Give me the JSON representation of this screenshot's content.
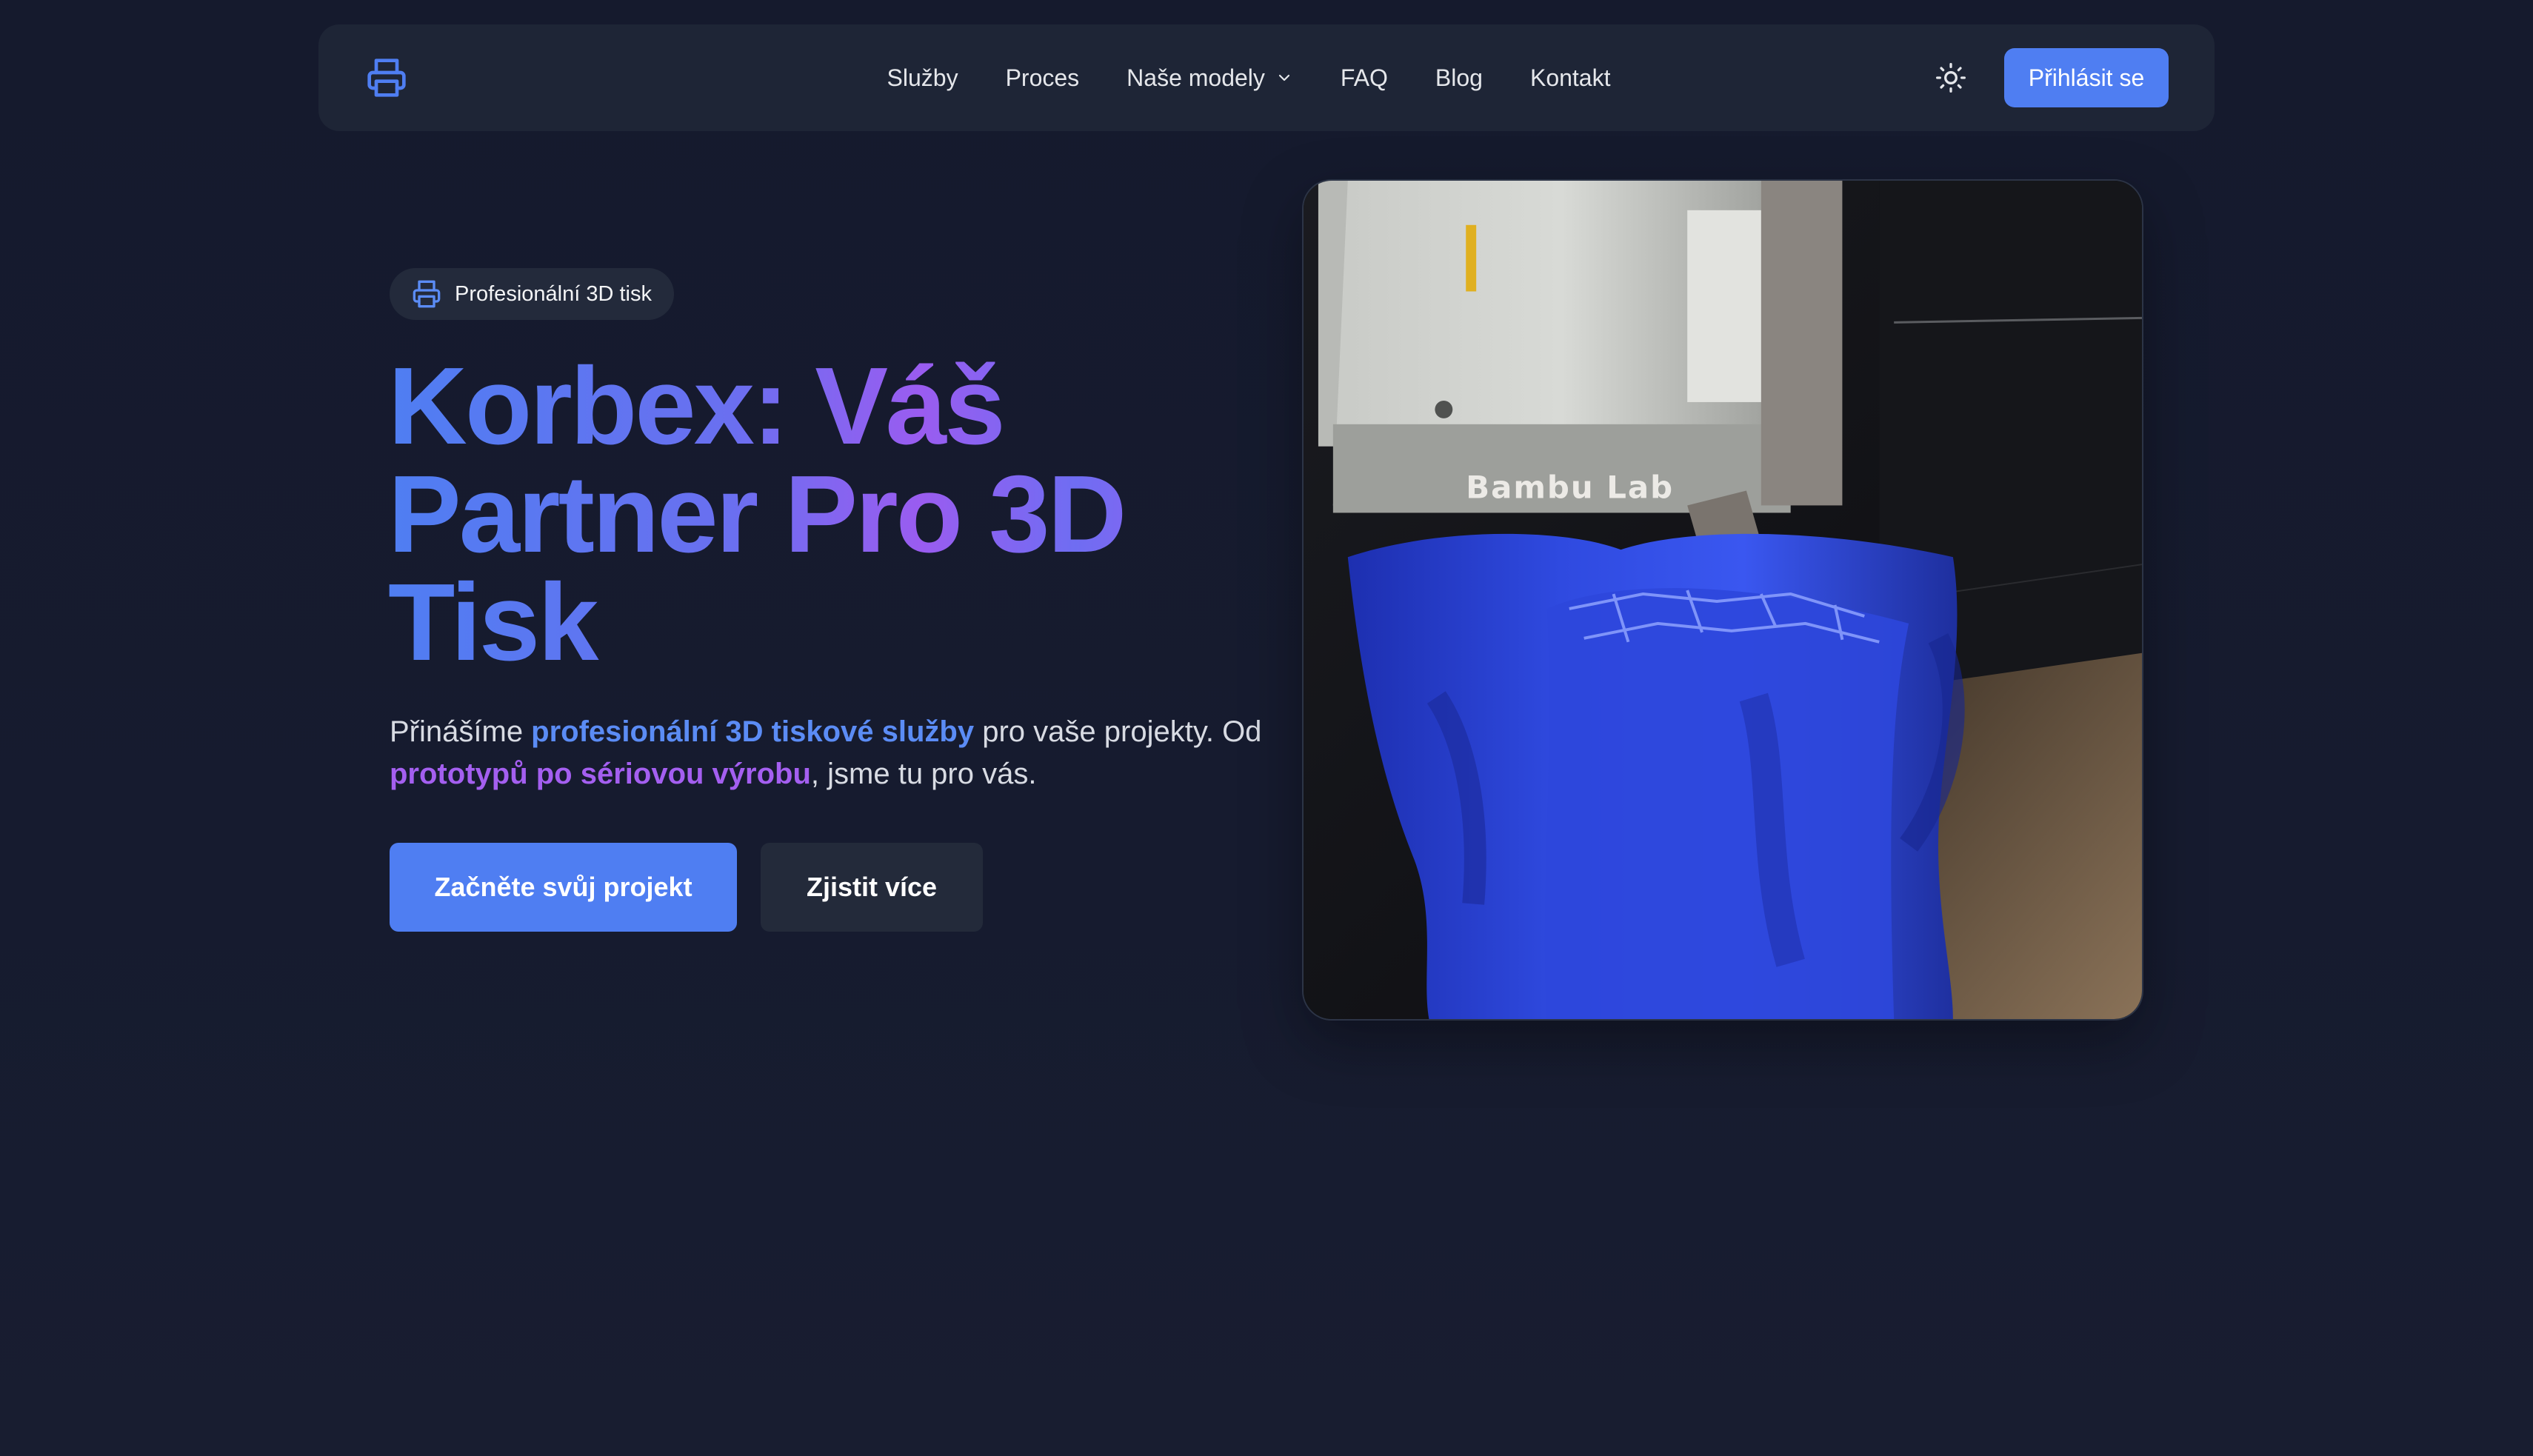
{
  "nav": {
    "logo_icon": "printer-icon",
    "links": [
      {
        "label": "Služby"
      },
      {
        "label": "Proces"
      },
      {
        "label": "Naše modely",
        "has_dropdown": true
      },
      {
        "label": "FAQ"
      },
      {
        "label": "Blog"
      },
      {
        "label": "Kontakt"
      }
    ],
    "theme_icon": "sun-icon",
    "login_label": "Přihlásit se"
  },
  "hero": {
    "badge_icon": "printer-icon",
    "badge_label": "Profesionální 3D tisk",
    "title": "Korbex: Váš Partner Pro 3D Tisk",
    "description": {
      "part1": "Přinášíme ",
      "highlight1": "profesionální 3D tiskové služby",
      "part2": " pro vaše projekty. Od ",
      "highlight2": "prototypů po sériovou výrobu",
      "part3": ", jsme tu pro vás."
    },
    "cta_primary": "Začněte svůj projekt",
    "cta_secondary": "Zjistit více",
    "media": {
      "printer_brand_text": "Bambu Lab"
    }
  },
  "colors": {
    "accent": "#4f7ef2",
    "purple": "#a45ff0",
    "background": "#161b2e",
    "navbar": "#1e2536"
  }
}
